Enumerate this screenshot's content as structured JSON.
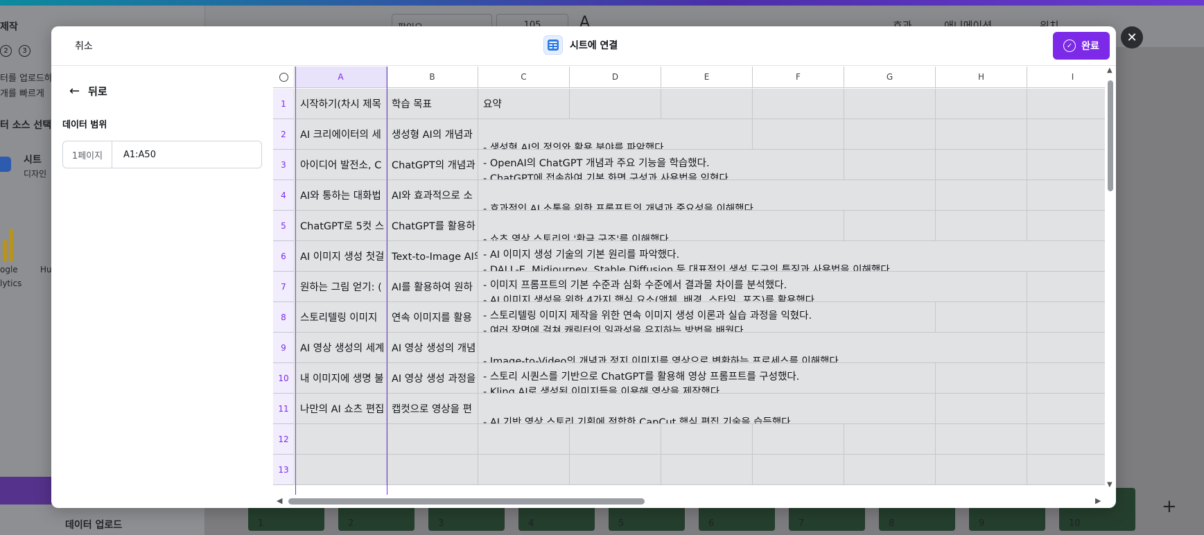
{
  "background": {
    "sidebar": {
      "heading": "제작",
      "steps": [
        "2",
        "3"
      ],
      "desc_line1": "터를 업로드하",
      "desc_line2": "개를 빠르게",
      "source_heading": "터 소스 선택",
      "sheet_label": "시트",
      "sheet_sub": "디자인",
      "app_label_1": "ogle",
      "app_label_2": "lytics",
      "app_label_3": "Hu",
      "upload_label": "데이터 업로드"
    },
    "toolbar": {
      "font_name": "팔있오",
      "font_size": "105",
      "effects_label": "효과",
      "animation_label": "애니메이션",
      "position_label": "위치"
    },
    "thumbnails": [
      "1",
      "2",
      "3",
      "4",
      "5",
      "6",
      "7",
      "8",
      "9",
      "10"
    ]
  },
  "modal": {
    "cancel_label": "취소",
    "title": "시트에 연결",
    "done_label": "완료",
    "close_icon": "close-icon",
    "back_label": "뒤로",
    "range_label": "데이터 범위",
    "page_selector": "1페이지",
    "range_value": "A1:A50"
  },
  "grid": {
    "columns": [
      "A",
      "B",
      "C",
      "D",
      "E",
      "F",
      "G",
      "H",
      "I"
    ],
    "rows": [
      "1",
      "2",
      "3",
      "4",
      "5",
      "6",
      "7",
      "8",
      "9",
      "10",
      "11",
      "12",
      "13"
    ],
    "selected_column": "A",
    "colA": [
      "시작하기(차시 제목",
      "AI 크리에이터의 세",
      "아이디어 발전소, C",
      "AI와 통하는 대화법",
      "ChatGPT로 5컷 스",
      "AI 이미지 생성 첫걸",
      "원하는 그림 얻기: (",
      "스토리텔링 이미지",
      "AI 영상 생성의 세계",
      "내 이미지에 생명 불",
      "나만의 AI 쇼츠 편집",
      "",
      ""
    ],
    "colB": [
      "학습 목표",
      "생성형 AI의 개념과",
      "ChatGPT의 개념과",
      "AI와 효과적으로 소",
      "ChatGPT를 활용하",
      "Text-to-Image AI의",
      "AI를 활용하여 원하",
      "연속 이미지를 활용",
      "AI 영상 생성의 개념",
      "AI 영상 생성 과정을",
      "캡컷으로 영상을 편",
      "",
      ""
    ],
    "colC_header": "요약",
    "summaries": [
      {
        "l1": "",
        "l2": "- 생성형 AI의 정의와 활용 분야를 파악했다."
      },
      {
        "l1": "- OpenAI의 ChatGPT 개념과 주요 기능을 학습했다.",
        "l2": "- ChatGPT에 접속하여 기본 화면 구성과 사용법을 익혔다."
      },
      {
        "l1": "",
        "l2": "- 효과적인 AI 소통을 위한 프롬프트의 개념과 중요성을 이해했다."
      },
      {
        "l1": "",
        "l2": "- 쇼츠 영상 스토리의 '황금 구조'를 이해했다."
      },
      {
        "l1": "- AI 이미지 생성 기술의 기본 원리를 파악했다.",
        "l2": "- DALL-E, Midjourney, Stable Diffusion 등 대표적인 생성 도구의 특징과 사용법을 이해했다."
      },
      {
        "l1": "- 이미지 프롬프트의 기본 수준과 심화 수준에서 결과물 차이를 분석했다.",
        "l2": "- AI 이미지 생성을 위한 4가지 핵심 요소(액체, 배경, 스타일, 포즈)를 활용했다."
      },
      {
        "l1": "- 스토리텔링 이미지 제작을 위한 연속 이미지 생성 이론과 실습 과정을 익혔다.",
        "l2": "- 여러 장면에 걸쳐 캐릭터의 일관성을 유지하는 방법을 배웠다."
      },
      {
        "l1": "",
        "l2": "- Image-to-Video의 개념과 정지 이미지를 영상으로 변환하는 프로세스를 이해했다."
      },
      {
        "l1": "- 스토리 시퀀스를 기반으로 ChatGPT를 활용해 영상 프롬프트를 구성했다.",
        "l2": "- Kling AI로 생성된 이미지들을 이용해 영상을 제작했다."
      },
      {
        "l1": "",
        "l2": "- AI 기반 영상 스토리 기획에 적합한 CapCut 핵심 편집 기술을 습득했다."
      }
    ]
  }
}
